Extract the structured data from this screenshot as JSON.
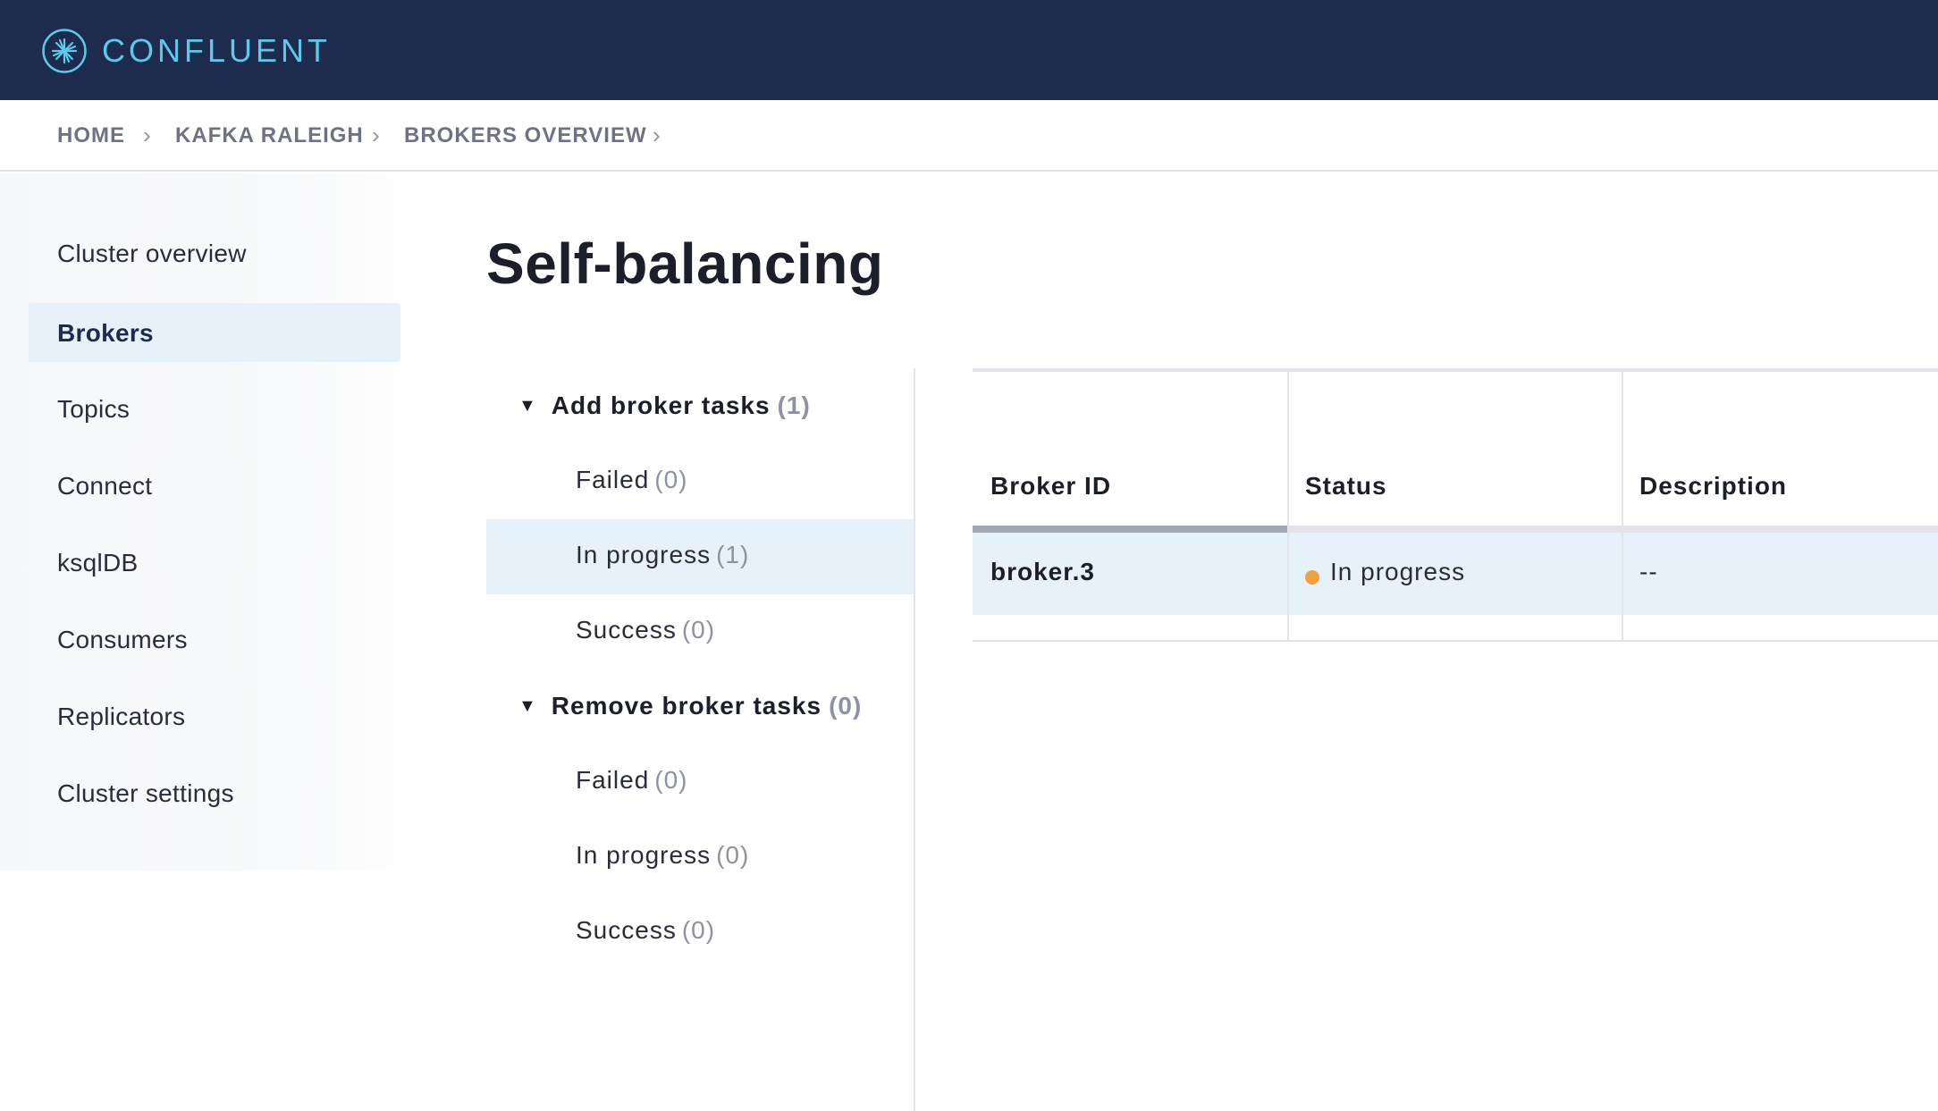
{
  "brand": {
    "name": "CONFLUENT"
  },
  "breadcrumb": [
    {
      "label": "HOME"
    },
    {
      "label": "KAFKA RALEIGH"
    },
    {
      "label": "BROKERS OVERVIEW"
    }
  ],
  "sidebar": {
    "items": [
      {
        "label": "Cluster overview",
        "active": false
      },
      {
        "label": "Brokers",
        "active": true
      },
      {
        "label": "Topics",
        "active": false
      },
      {
        "label": "Connect",
        "active": false
      },
      {
        "label": "ksqlDB",
        "active": false
      },
      {
        "label": "Consumers",
        "active": false
      },
      {
        "label": "Replicators",
        "active": false
      },
      {
        "label": "Cluster settings",
        "active": false
      }
    ]
  },
  "page": {
    "title": "Self-balancing"
  },
  "tasks": {
    "groups": [
      {
        "label": "Add broker tasks",
        "count": "(1)",
        "items": [
          {
            "label": "Failed",
            "count": "(0)",
            "selected": false
          },
          {
            "label": "In progress",
            "count": "(1)",
            "selected": true
          },
          {
            "label": "Success",
            "count": "(0)",
            "selected": false
          }
        ]
      },
      {
        "label": "Remove broker tasks",
        "count": "(0)",
        "items": [
          {
            "label": "Failed",
            "count": "(0)",
            "selected": false
          },
          {
            "label": "In progress",
            "count": "(0)",
            "selected": false
          },
          {
            "label": "Success",
            "count": "(0)",
            "selected": false
          }
        ]
      }
    ]
  },
  "table": {
    "columns": [
      "Broker ID",
      "Status",
      "Description"
    ],
    "rows": [
      {
        "broker_id": "broker.3",
        "status": "In progress",
        "description": "--"
      }
    ]
  },
  "colors": {
    "topbar": "#1c2b4e",
    "brand_accent": "#5ec8e8",
    "selection": "#e7f1f9",
    "status_in_progress": "#f0a03c"
  },
  "icons": {
    "logo": "confluent-logo-icon",
    "breadcrumb_separator": "chevron-right-icon",
    "group_toggle": "caret-down-icon",
    "status": "status-dot-icon"
  }
}
